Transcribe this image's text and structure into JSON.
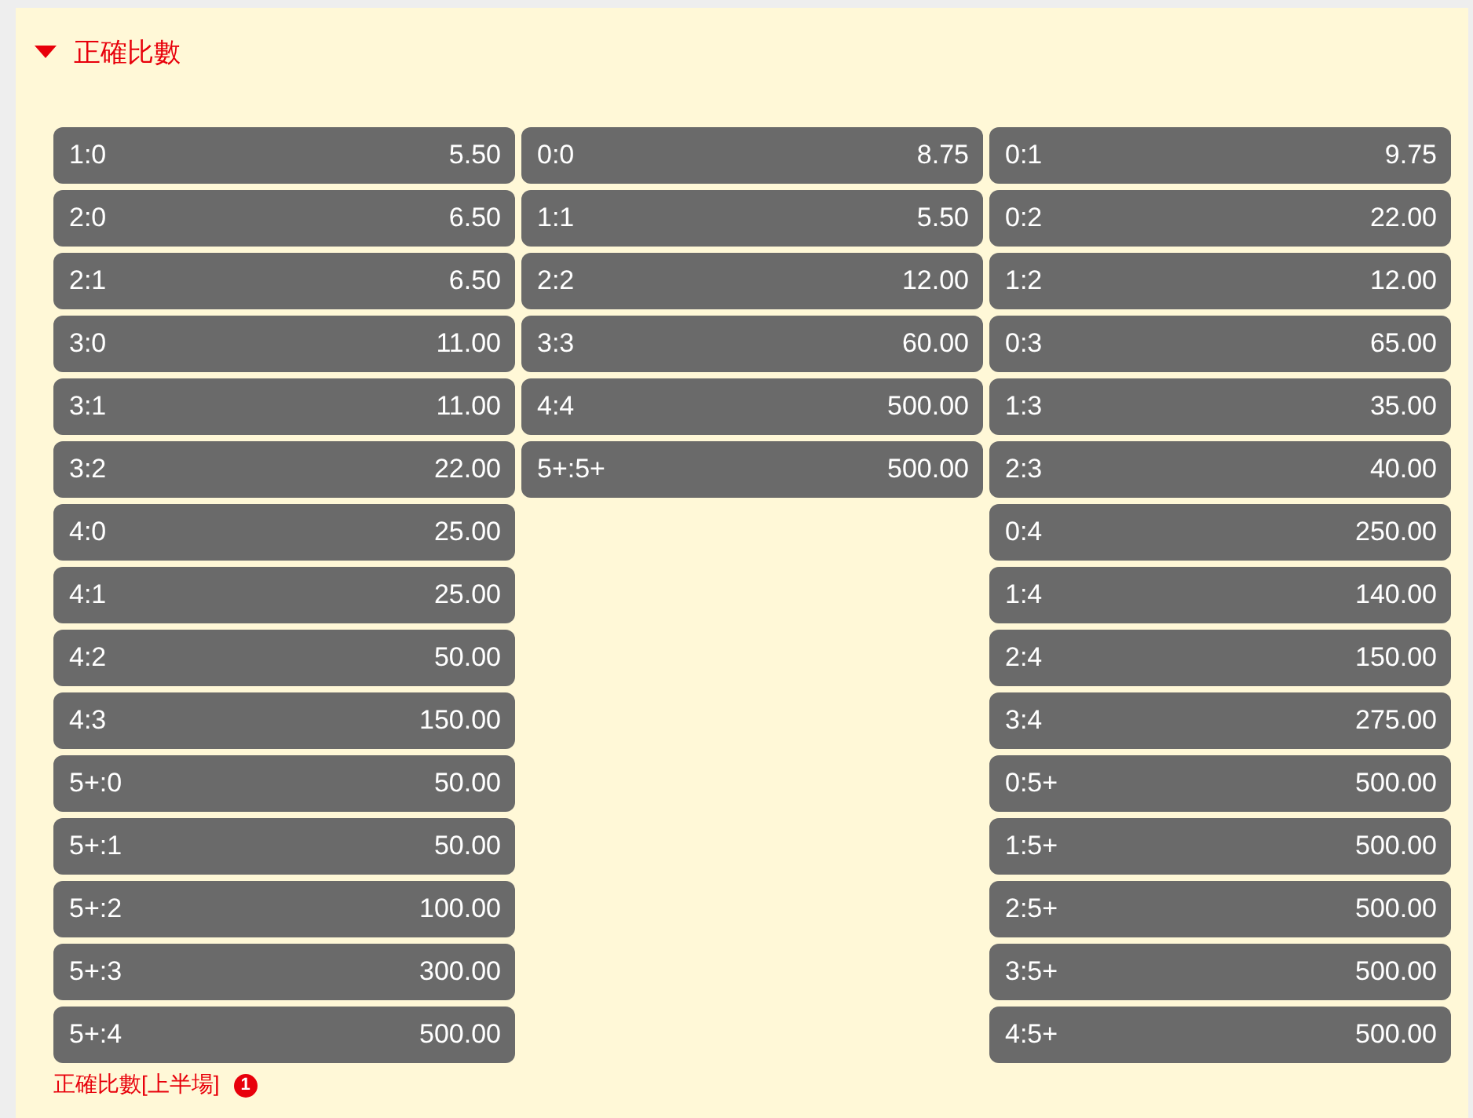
{
  "section": {
    "title": "正確比數",
    "expanded": true
  },
  "columns": [
    {
      "cells": [
        {
          "score": "1:0",
          "odds": "5.50"
        },
        {
          "score": "2:0",
          "odds": "6.50"
        },
        {
          "score": "2:1",
          "odds": "6.50"
        },
        {
          "score": "3:0",
          "odds": "11.00"
        },
        {
          "score": "3:1",
          "odds": "11.00"
        },
        {
          "score": "3:2",
          "odds": "22.00"
        },
        {
          "score": "4:0",
          "odds": "25.00"
        },
        {
          "score": "4:1",
          "odds": "25.00"
        },
        {
          "score": "4:2",
          "odds": "50.00"
        },
        {
          "score": "4:3",
          "odds": "150.00"
        },
        {
          "score": "5+:0",
          "odds": "50.00"
        },
        {
          "score": "5+:1",
          "odds": "50.00"
        },
        {
          "score": "5+:2",
          "odds": "100.00"
        },
        {
          "score": "5+:3",
          "odds": "300.00"
        },
        {
          "score": "5+:4",
          "odds": "500.00"
        }
      ]
    },
    {
      "cells": [
        {
          "score": "0:0",
          "odds": "8.75"
        },
        {
          "score": "1:1",
          "odds": "5.50"
        },
        {
          "score": "2:2",
          "odds": "12.00"
        },
        {
          "score": "3:3",
          "odds": "60.00"
        },
        {
          "score": "4:4",
          "odds": "500.00"
        },
        {
          "score": "5+:5+",
          "odds": "500.00"
        }
      ]
    },
    {
      "cells": [
        {
          "score": "0:1",
          "odds": "9.75"
        },
        {
          "score": "0:2",
          "odds": "22.00"
        },
        {
          "score": "1:2",
          "odds": "12.00"
        },
        {
          "score": "0:3",
          "odds": "65.00"
        },
        {
          "score": "1:3",
          "odds": "35.00"
        },
        {
          "score": "2:3",
          "odds": "40.00"
        },
        {
          "score": "0:4",
          "odds": "250.00"
        },
        {
          "score": "1:4",
          "odds": "140.00"
        },
        {
          "score": "2:4",
          "odds": "150.00"
        },
        {
          "score": "3:4",
          "odds": "275.00"
        },
        {
          "score": "0:5+",
          "odds": "500.00"
        },
        {
          "score": "1:5+",
          "odds": "500.00"
        },
        {
          "score": "2:5+",
          "odds": "500.00"
        },
        {
          "score": "3:5+",
          "odds": "500.00"
        },
        {
          "score": "4:5+",
          "odds": "500.00"
        }
      ]
    }
  ],
  "footer": {
    "link": "正確比數[上半場]",
    "badge": "1"
  }
}
